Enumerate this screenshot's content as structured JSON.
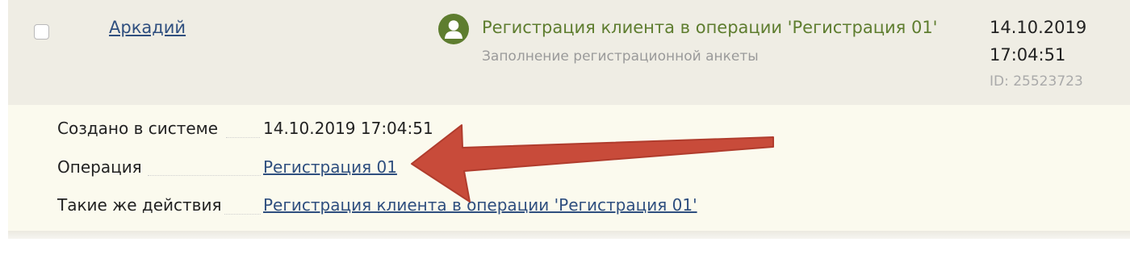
{
  "entry": {
    "user_name": "Аркадий",
    "action_title": "Регистрация клиента в операции 'Регистрация 01'",
    "action_subtitle": "Заполнение регистрационной анкеты",
    "date": "14.10.2019",
    "time": "17:04:51",
    "id_label": "ID: 25523723",
    "avatar_icon": "user-avatar-icon",
    "colors": {
      "row_background": "#efede4",
      "detail_background": "#fbfaee",
      "title_green": "#5e7d2f",
      "link_blue": "#2f4f7f",
      "arrow_red": "#c84b3a"
    }
  },
  "details": {
    "created_label": "Создано в системе",
    "created_value": "14.10.2019 17:04:51",
    "operation_label": "Операция",
    "operation_value": "Регистрация 01",
    "same_actions_label": "Такие же действия",
    "same_actions_value": "Регистрация клиента в операции 'Регистрация 01'"
  }
}
